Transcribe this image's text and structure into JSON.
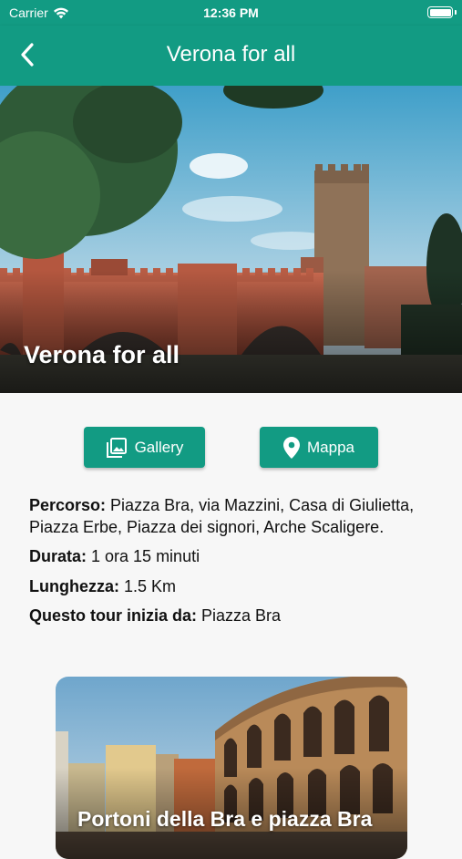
{
  "status_bar": {
    "carrier": "Carrier",
    "time": "12:36 PM"
  },
  "nav": {
    "title": "Verona for all"
  },
  "hero": {
    "title": "Verona for all"
  },
  "buttons": {
    "gallery": "Gallery",
    "map": "Mappa"
  },
  "tour": {
    "route_label": "Percorso:",
    "route_value": " Piazza Bra, via Mazzini, Casa di Giulietta, Piazza Erbe, Piazza dei signori, Arche Scaligere.",
    "duration_label": "Durata:",
    "duration_value": " 1 ora 15 minuti",
    "length_label": "Lunghezza:",
    "length_value": " 1.5 Km",
    "start_label": "Questo tour inizia da:",
    "start_value": " Piazza Bra"
  },
  "stop_card": {
    "title": "Portoni della Bra e piazza Bra"
  },
  "colors": {
    "primary": "#129b83",
    "background": "#f7f7f7",
    "text": "#111111"
  }
}
